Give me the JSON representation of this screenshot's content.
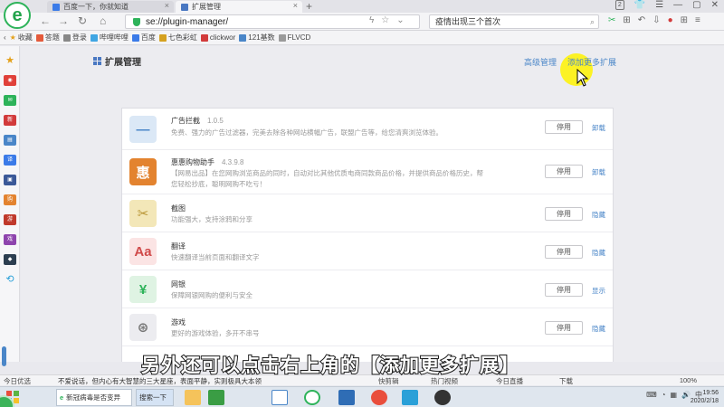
{
  "tabs": [
    {
      "label": "百度一下，你就知道"
    },
    {
      "label": "扩展管理"
    }
  ],
  "address": {
    "url": "se://plugin-manager/",
    "search": "疫情出现三个首次"
  },
  "toolbar": {
    "badge": "2"
  },
  "bookmarks": [
    {
      "label": "收藏"
    },
    {
      "label": "答题"
    },
    {
      "label": "登录"
    },
    {
      "label": "哔哩哔哩"
    },
    {
      "label": "百度"
    },
    {
      "label": "七色彩虹"
    },
    {
      "label": "clickwor"
    },
    {
      "label": "121基数"
    },
    {
      "label": "FLVCD"
    }
  ],
  "header": {
    "title": "扩展管理",
    "advanced_link": "高级管理",
    "add_more_link": "添加更多扩展"
  },
  "extensions": [
    {
      "name": "广告拦截",
      "version": "1.0.5",
      "desc": "免费、强力的广告过滤器，完美去除各种网站横幅广告，联盟广告等，给您清爽浏览体验。",
      "button": "停用",
      "action": "卸载",
      "icon_char": "—",
      "icon_bg": "#dbe8f6",
      "icon_fg": "#4a86c8"
    },
    {
      "name": "惠惠购物助手",
      "version": "4.3.9.8",
      "desc": "【网易出品】在您网购浏览商品的同时，自动对比其他优质电商同款商品价格，并提供商品价格历史，帮您轻松抄底，聪明网购不吃亏！",
      "button": "停用",
      "action": "卸载",
      "icon_char": "惠",
      "icon_bg": "#e3832f",
      "icon_fg": "#ffffff"
    },
    {
      "name": "截图",
      "version": "",
      "desc": "功能强大，支持涂鸦和分享",
      "button": "停用",
      "action": "隐藏",
      "icon_char": "✂",
      "icon_bg": "#f3e7b8",
      "icon_fg": "#b89433"
    },
    {
      "name": "翻译",
      "version": "",
      "desc": "快速翻译当前页面和翻译文字",
      "button": "停用",
      "action": "隐藏",
      "icon_char": "Aa",
      "icon_bg": "#fbe4e4",
      "icon_fg": "#d04a4a"
    },
    {
      "name": "网银",
      "version": "",
      "desc": "保障网银网购的便利与安全",
      "button": "停用",
      "action": "显示",
      "icon_char": "¥",
      "icon_bg": "#dff3e3",
      "icon_fg": "#2eb35a"
    },
    {
      "name": "游戏",
      "version": "",
      "desc": "更好的游戏体验，多开不串号",
      "button": "停用",
      "action": "隐藏",
      "icon_char": "⊛",
      "icon_bg": "#ececf0",
      "icon_fg": "#777777"
    }
  ],
  "caption": "另外还可以点击右上角的【添加更多扩展】",
  "statusbar": {
    "left": "今日优选",
    "news": "不爱说话，但内心有大智慧的三大星座，表面平静，实则极具大本领",
    "quick": "快剪辑",
    "video": "热门视频",
    "hot": "今日直播",
    "download": "下载",
    "zoom": "100%"
  },
  "taskbar": {
    "task1": "新冠病毒是否变异",
    "task2": "搜索一下",
    "time": "19:56",
    "date": "2020/2/18",
    "lang": "中"
  }
}
